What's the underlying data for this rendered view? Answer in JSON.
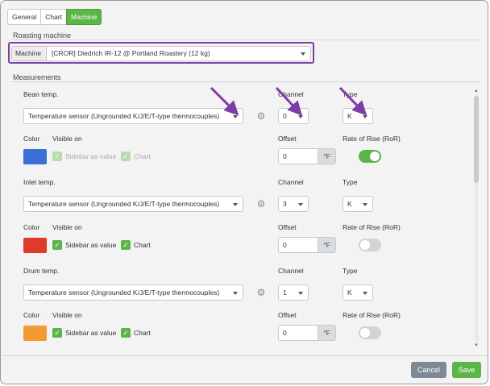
{
  "tabs": [
    {
      "label": "General"
    },
    {
      "label": "Chart"
    },
    {
      "label": "Machine"
    }
  ],
  "roasting": {
    "title": "Roasting machine",
    "machine_label": "Machine",
    "machine_value": "[CROR] Diedrich IR-12 @ Portland Roastery (12 kg)"
  },
  "measurements": {
    "title": "Measurements",
    "headers": {
      "channel": "Channel",
      "type": "Type",
      "color": "Color",
      "visible_on": "Visible on",
      "offset": "Offset",
      "ror": "Rate of Rise (RoR)"
    },
    "items": [
      {
        "name": "Bean temp.",
        "sensor": "Temperature sensor (Ungrounded K/J/E/T-type thermocouples)",
        "channel": "0",
        "type": "K",
        "color": "#3b6fd6",
        "sidebar_label": "Sidebar as value",
        "chart_label": "Chart",
        "offset": "0",
        "unit": "°F"
      },
      {
        "name": "Inlet temp.",
        "sensor": "Temperature sensor (Ungrounded K/J/E/T-type thermocouples)",
        "channel": "3",
        "type": "K",
        "color": "#e03a2a",
        "sidebar_label": "Sidebar as value",
        "chart_label": "Chart",
        "offset": "0",
        "unit": "°F"
      },
      {
        "name": "Drum temp.",
        "sensor": "Temperature sensor (Ungrounded K/J/E/T-type thermocouples)",
        "channel": "1",
        "type": "K",
        "color": "#f49a32",
        "sidebar_label": "Sidebar as value",
        "chart_label": "Chart",
        "offset": "0",
        "unit": "°F"
      }
    ]
  },
  "buttons": {
    "cancel": "Cancel",
    "save": "Save"
  },
  "accent_colors": {
    "green": "#5cb548",
    "purple_annotation": "#7b3ea6",
    "cancel_grey": "#7d8a96"
  },
  "icons": [
    "gear-icon",
    "chevron-down-icon",
    "check-icon",
    "chevron-up-icon"
  ]
}
